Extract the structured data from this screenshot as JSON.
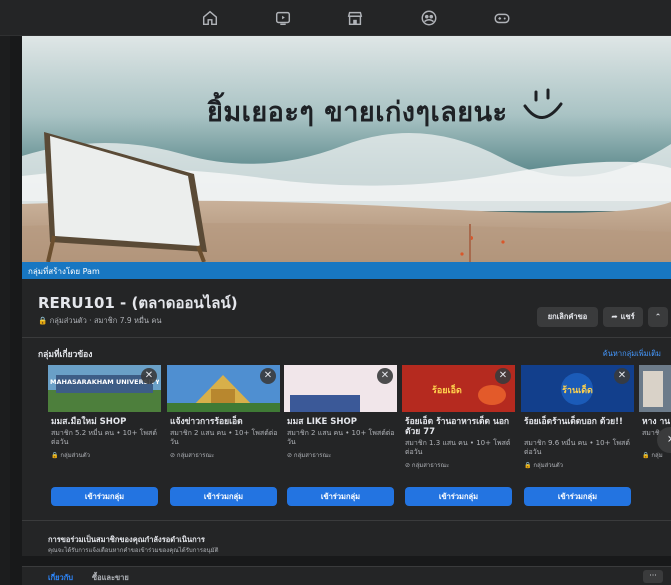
{
  "nav": {
    "icons": [
      "home-icon",
      "watch-icon",
      "marketplace-icon",
      "groups-icon",
      "gaming-icon"
    ]
  },
  "cover": {
    "handwriting": "ยิ้มเยอะๆ ขายเก่งๆเลยนะ",
    "caption": "กลุ่มที่สร้างโดย Pam"
  },
  "group": {
    "title": "RERU101 - (ตลาดออนไลน์)",
    "meta": "🔒 กลุ่มส่วนตัว · สมาชิก 7.9 หมื่น คน",
    "cancel_request_label": "ยกเลิกคำขอ",
    "share_label": "แชร์",
    "more_label": "⌃"
  },
  "related": {
    "title": "กลุ่มที่เกี่ยวข้อง",
    "see_all": "ค้นหากลุ่มเพิ่มเติม",
    "join_label": "เข้าร่วมกลุ่ม",
    "cards": [
      {
        "name": "มมส.มือใหม่ SHOP",
        "meta": "สมาชิก 5.2 หมื่น คน • 10+ โพสต์ต่อวัน",
        "privacy": "🔒 กลุ่มส่วนตัว",
        "image_text": "MAHASARAKHAM UNIVERSITY"
      },
      {
        "name": "แจ้งข่าวการร้อยเอ็ด",
        "meta": "สมาชิก 2 แสน คน • 10+ โพสต์ต่อวัน",
        "privacy": "⊘ กลุ่มสาธารณะ",
        "image_text": ""
      },
      {
        "name": "มมส LIKE SHOP",
        "meta": "สมาชิก 2 แสน คน • 10+ โพสต์ต่อวัน",
        "privacy": "⊘ กลุ่มสาธารณะ",
        "image_text": ""
      },
      {
        "name": "ร้อยเอ็ด ร้านอาหารเด็ด นอกตัวย 77",
        "meta": "สมาชิก 1.3 แสน คน • 10+ โพสต์ต่อวัน",
        "privacy": "⊘ กลุ่มสาธารณะ",
        "image_text": "ร้อยเอ็ด"
      },
      {
        "name": "ร้อยเอ็ดร้านเด็ดบอก ด้วย!!",
        "meta": "สมาชิก 9.6 หมื่น คน • 10+ โพสต์ต่อวัน",
        "privacy": "🔒 กลุ่มส่วนตัว",
        "image_text": "ร้านเด็ด"
      },
      {
        "name": "หาง าน",
        "meta": "สมาชิก",
        "privacy": "🔒 กลุ่ม",
        "image_text": ""
      }
    ]
  },
  "notice": {
    "title": "การขอร่วมเป็นสมาชิกของคุณกำลังรอดำเนินการ",
    "subtitle": "คุณจะได้รับการแจ้งเตือนหากคำขอเข้าร่วมของคุณได้รับการอนุมัติ"
  },
  "tabs": {
    "items": [
      "เกี่ยวกับ",
      "ซื้อและขาย"
    ],
    "more": "···"
  },
  "colors": {
    "accent": "#2374e1",
    "caption_bar": "#1877c2",
    "background": "#18191a",
    "surface": "#242526"
  }
}
